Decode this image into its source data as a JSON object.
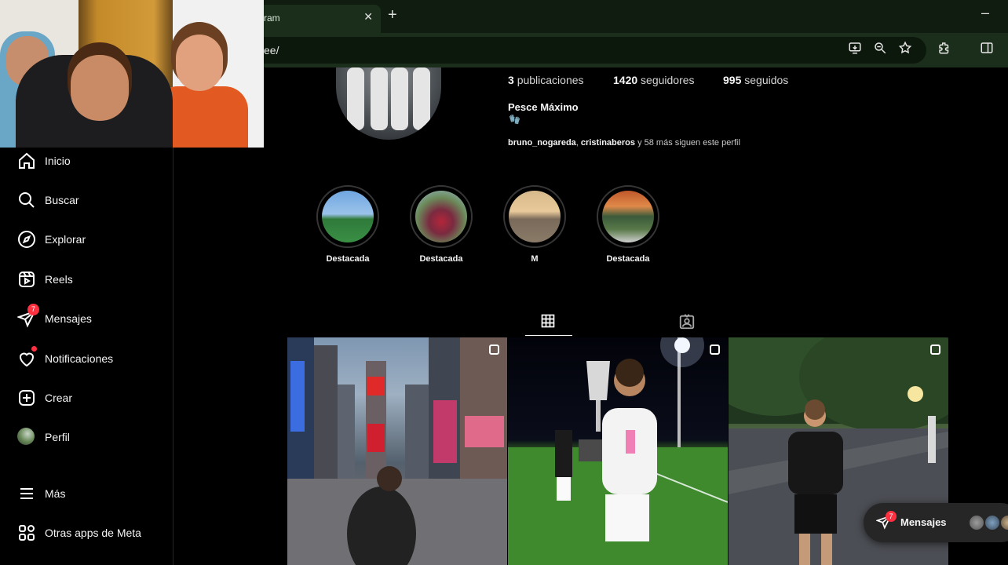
{
  "browser": {
    "tab_title": "ram",
    "tab_close": "✕",
    "new_tab": "+",
    "minimize": "–",
    "url": "ee/"
  },
  "profile": {
    "posts_count": "3",
    "posts_label": "publicaciones",
    "followers_count": "1420",
    "followers_label": "seguidores",
    "following_count": "995",
    "following_label": "seguidos",
    "name": "Pesce Máximo",
    "bio_emoji": "🧤",
    "followed_by_1": "bruno_nogareda",
    "followed_by_sep": ", ",
    "followed_by_2": "cristinaberos",
    "followed_by_rest": " y 58 más siguen este perfil"
  },
  "sidebar": {
    "items": [
      {
        "label": "Inicio",
        "icon": "home-icon"
      },
      {
        "label": "Buscar",
        "icon": "search-icon"
      },
      {
        "label": "Explorar",
        "icon": "compass-icon"
      },
      {
        "label": "Reels",
        "icon": "reels-icon"
      },
      {
        "label": "Mensajes",
        "icon": "messages-icon",
        "badge": "7"
      },
      {
        "label": "Notificaciones",
        "icon": "heart-icon"
      },
      {
        "label": "Crear",
        "icon": "plus-square-icon"
      },
      {
        "label": "Perfil",
        "icon": "profile-avatar"
      },
      {
        "label": "Más",
        "icon": "menu-icon"
      },
      {
        "label": "Otras apps de Meta",
        "icon": "meta-apps-icon"
      }
    ]
  },
  "highlights": [
    {
      "label": "Destacada"
    },
    {
      "label": "Destacada"
    },
    {
      "label": "M"
    },
    {
      "label": "Destacada"
    }
  ],
  "messages_pill": {
    "label": "Mensajes",
    "badge": "7"
  },
  "colors": {
    "background": "#000000",
    "badge": "#ff3040",
    "browser_chrome": "#1b2e1b",
    "browser_tabbar": "#0f1c0f"
  }
}
